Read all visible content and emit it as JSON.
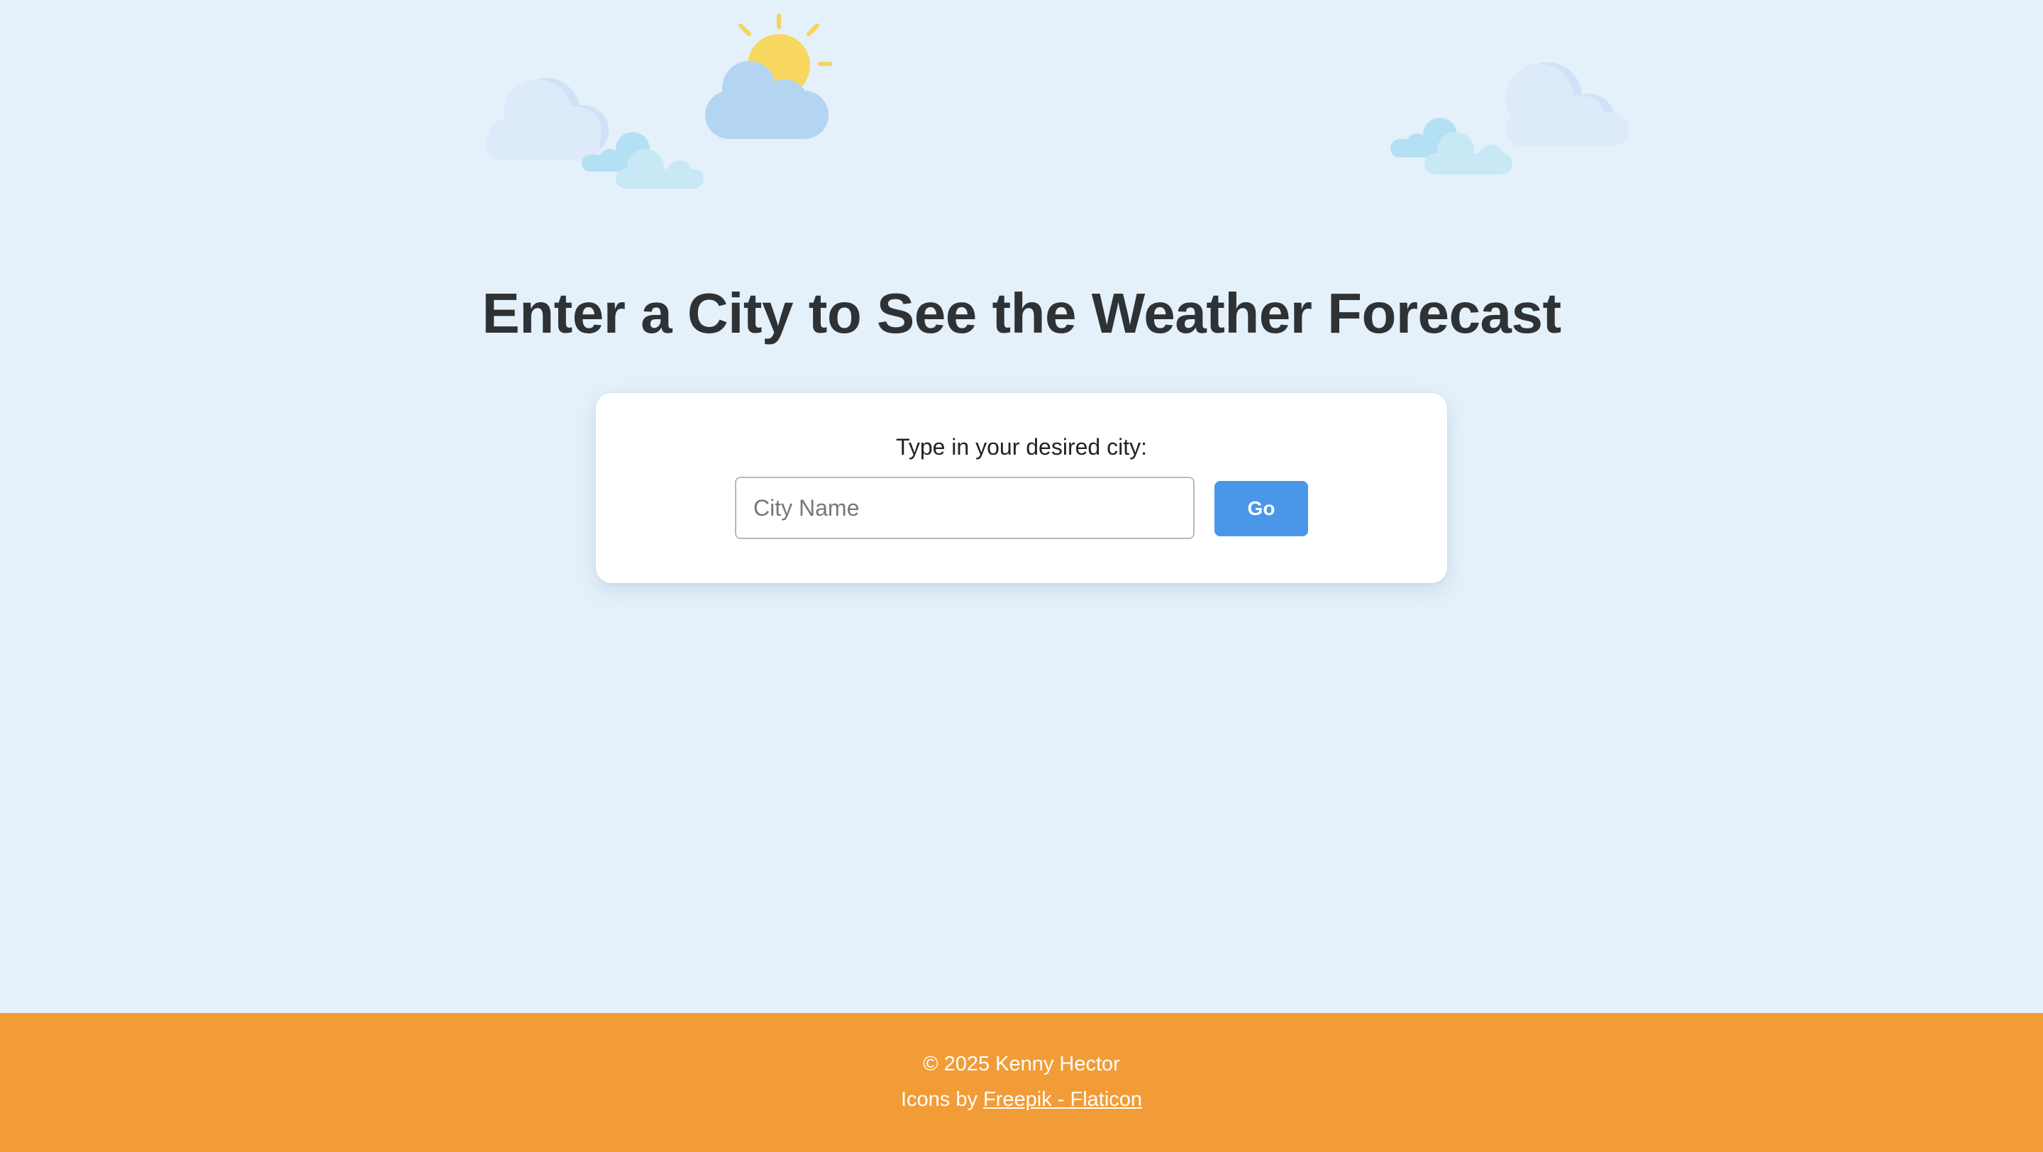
{
  "page": {
    "title": "Enter a City to See the Weather Forecast"
  },
  "search": {
    "label": "Type in your desired city:",
    "placeholder": "City Name",
    "value": "",
    "button_label": "Go"
  },
  "footer": {
    "copyright": "© 2025 Kenny Hector",
    "credits_prefix": "Icons by ",
    "credits_link": "Freepik - Flaticon"
  },
  "colors": {
    "background": "#e4f1fb",
    "accent_button": "#4a97ea",
    "footer": "#f29c37",
    "title_text": "#2f3234"
  },
  "icons": [
    "sun-behind-cloud-icon",
    "cloud-icon"
  ]
}
